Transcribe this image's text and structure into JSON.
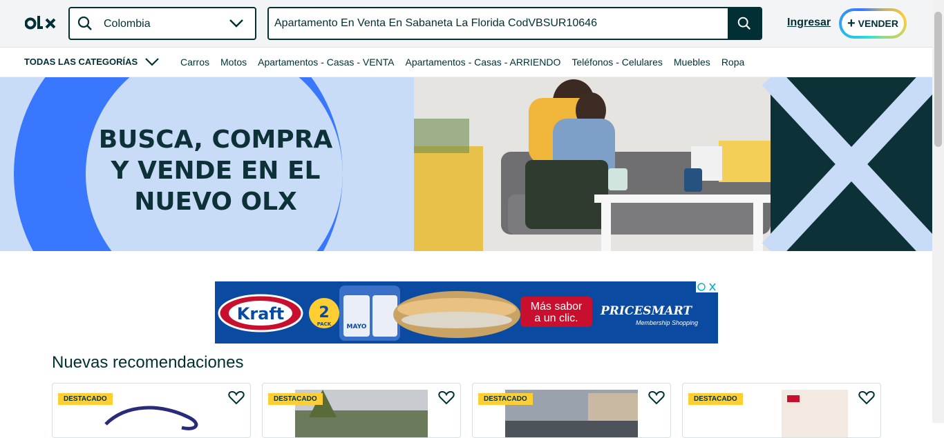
{
  "header": {
    "logo_text": "olx",
    "location": "Colombia",
    "search_value": "Apartamento En Venta En Sabaneta La Florida CodVBSUR10646",
    "login_label": "Ingresar",
    "sell_label": "VENDER"
  },
  "categories": {
    "all_label": "TODAS LAS CATEGORÍAS",
    "items": [
      "Carros",
      "Motos",
      "Apartamentos - Casas - VENTA",
      "Apartamentos - Casas - ARRIENDO",
      "Teléfonos - Celulares",
      "Muebles",
      "Ropa"
    ]
  },
  "banner": {
    "line1": "BUSCA, COMPRA",
    "line2": "Y VENDE EN EL",
    "line3": "NUEVO OLX"
  },
  "ad": {
    "brand1": "Kraft",
    "pack_num": "2",
    "pack_label": "PACK",
    "product": "MAYO",
    "slogan1": "Más sabor",
    "slogan2": "a un clic.",
    "brand2": "PRICESMART",
    "brand2_sub": "Membership Shopping"
  },
  "recommendations": {
    "title": "Nuevas recomendaciones",
    "badge": "DESTACADO",
    "cards": [
      "",
      "",
      "",
      ""
    ]
  },
  "colors": {
    "primary": "#002f34",
    "accent_blue": "#3a77ff",
    "light_blue": "#c8dcf8",
    "badge_yellow": "#ffce32"
  }
}
